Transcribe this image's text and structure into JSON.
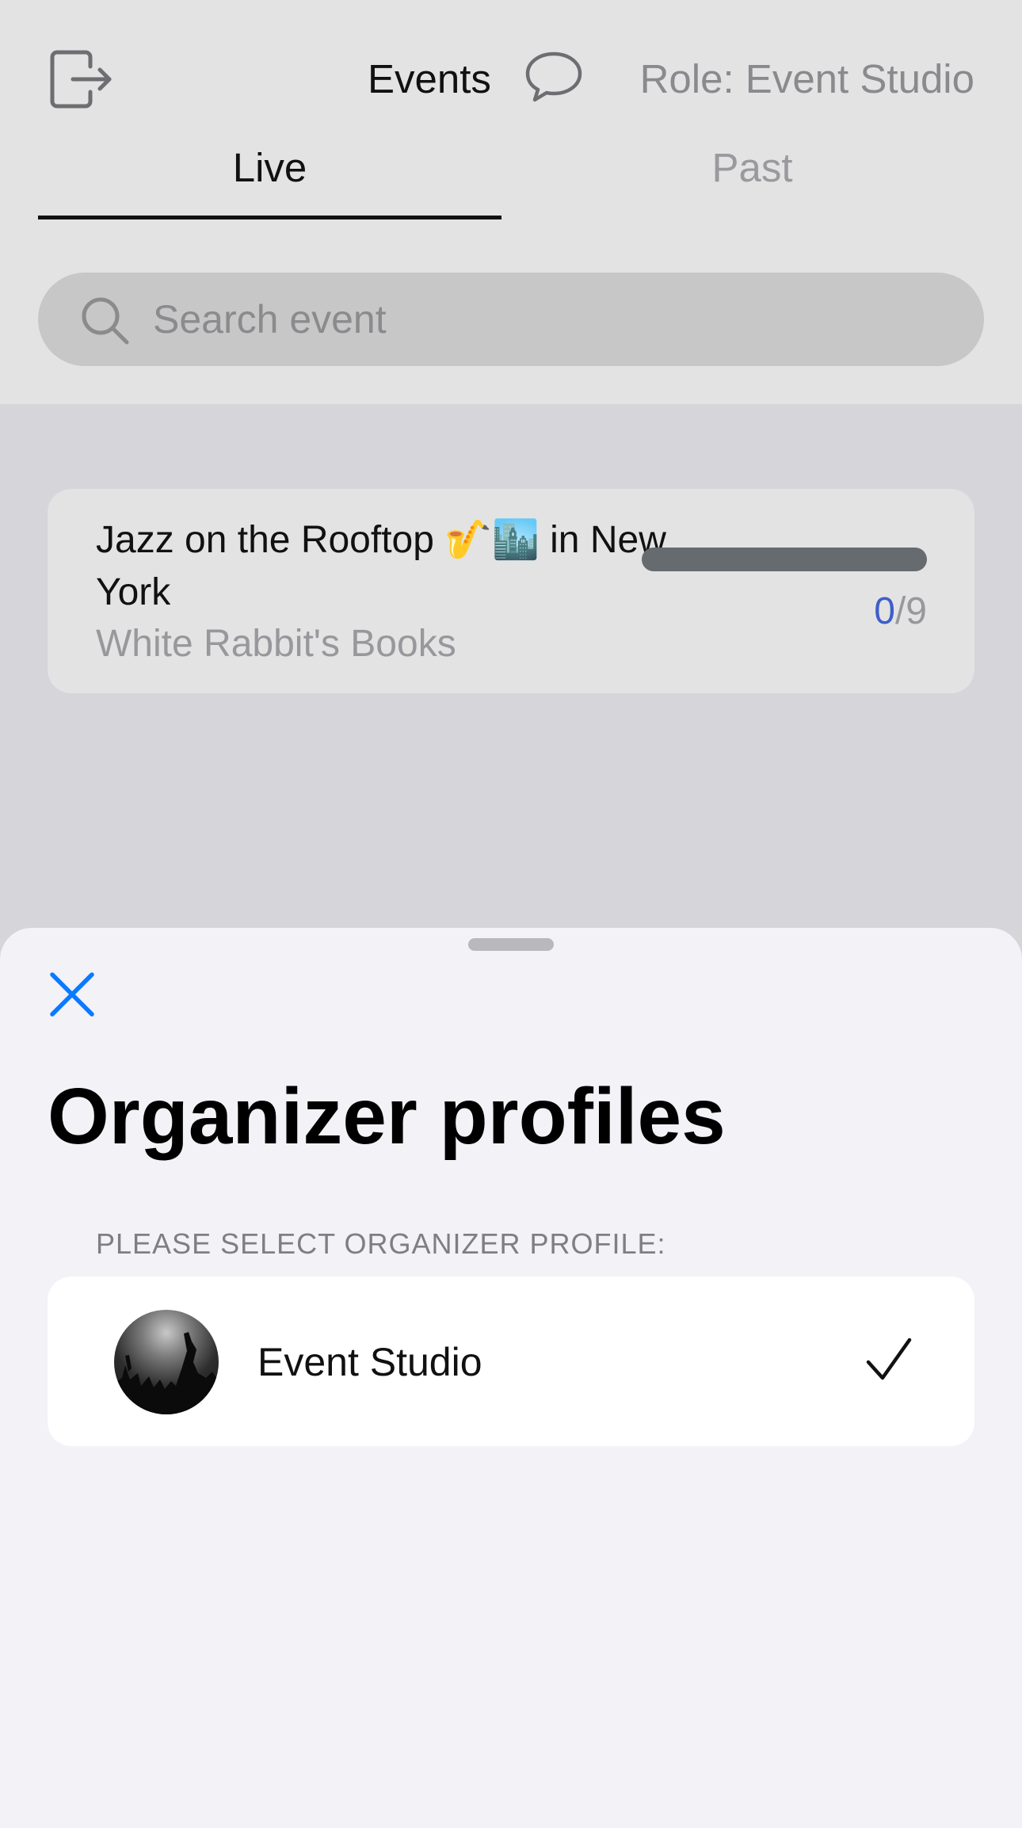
{
  "header": {
    "exit_icon": "exit-icon",
    "title": "Events",
    "chat_icon": "chat-bubble-icon",
    "role_label": "Role: Event Studio"
  },
  "tabs": [
    {
      "label": "Live",
      "selected": true
    },
    {
      "label": "Past",
      "selected": false
    }
  ],
  "search": {
    "icon": "search-icon",
    "placeholder": "Search event",
    "value": ""
  },
  "events": [
    {
      "title": "Jazz on the Rooftop 🎷🏙️ in New York",
      "venue": "White Rabbit's Books",
      "checked_in": "0",
      "separator": "/",
      "total": "9",
      "progress_fraction": 0
    }
  ],
  "sheet": {
    "close_icon": "close-icon",
    "title": "Organizer profiles",
    "section_header": "PLEASE SELECT ORGANIZER PROFILE:",
    "profiles": [
      {
        "name": "Event Studio",
        "selected": true,
        "avatar": "concert-crowd-photo",
        "check_icon": "checkmark-icon"
      }
    ]
  },
  "colors": {
    "accent_blue": "#0a7aff",
    "progress_count_blue": "#3e5ec8",
    "sheet_background": "#f2f2f7",
    "dimmed_background": "#d5d5da"
  }
}
